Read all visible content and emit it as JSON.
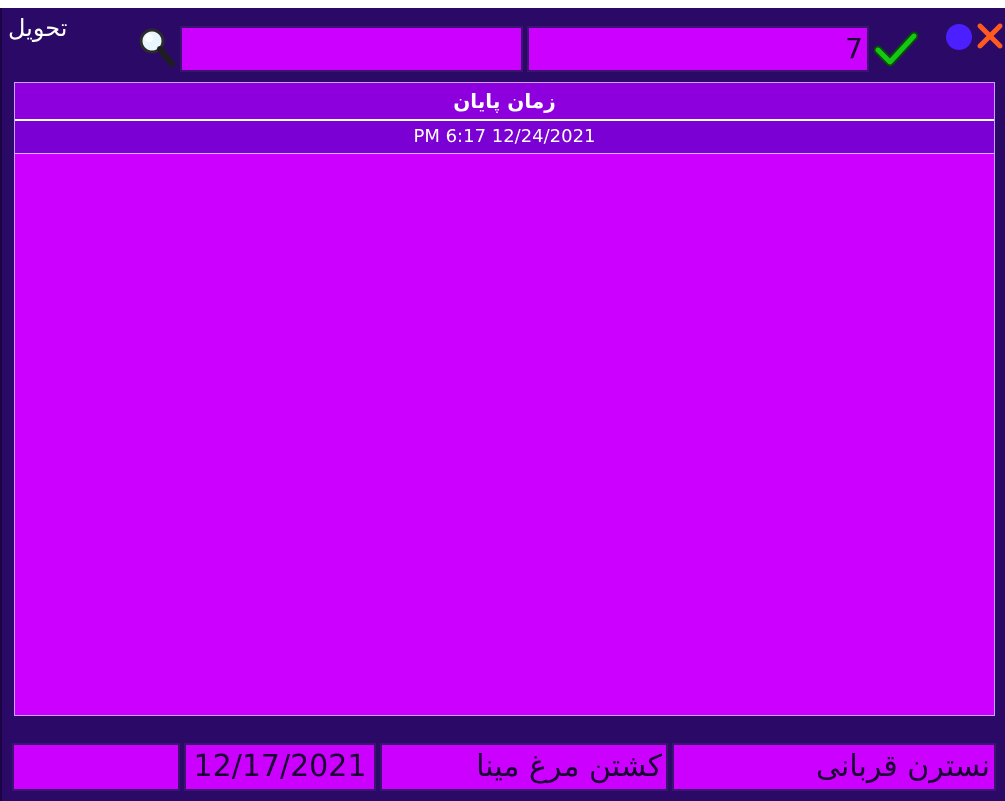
{
  "window": {
    "title": "تحويل"
  },
  "toolbar": {
    "search_value": "",
    "code_value": "7"
  },
  "grid": {
    "header": "زمان پایان",
    "rows": [
      "PM 6:17 12/24/2021"
    ]
  },
  "footer": {
    "field1": "",
    "date": "12/17/2021",
    "task": "کشتن مرغ مینا",
    "name": "نسترن قربانی"
  },
  "colors": {
    "window_bg": "#2a0a66",
    "field_bg": "#cc00ff",
    "header_bg": "#8d00dd",
    "row_bg": "#7a00d4",
    "check_green": "#14c814",
    "close_orange": "#ff5a1f",
    "dot_blue": "#4b1fff"
  },
  "icons": [
    "search-icon",
    "check-icon",
    "status-dot-icon",
    "close-icon"
  ]
}
